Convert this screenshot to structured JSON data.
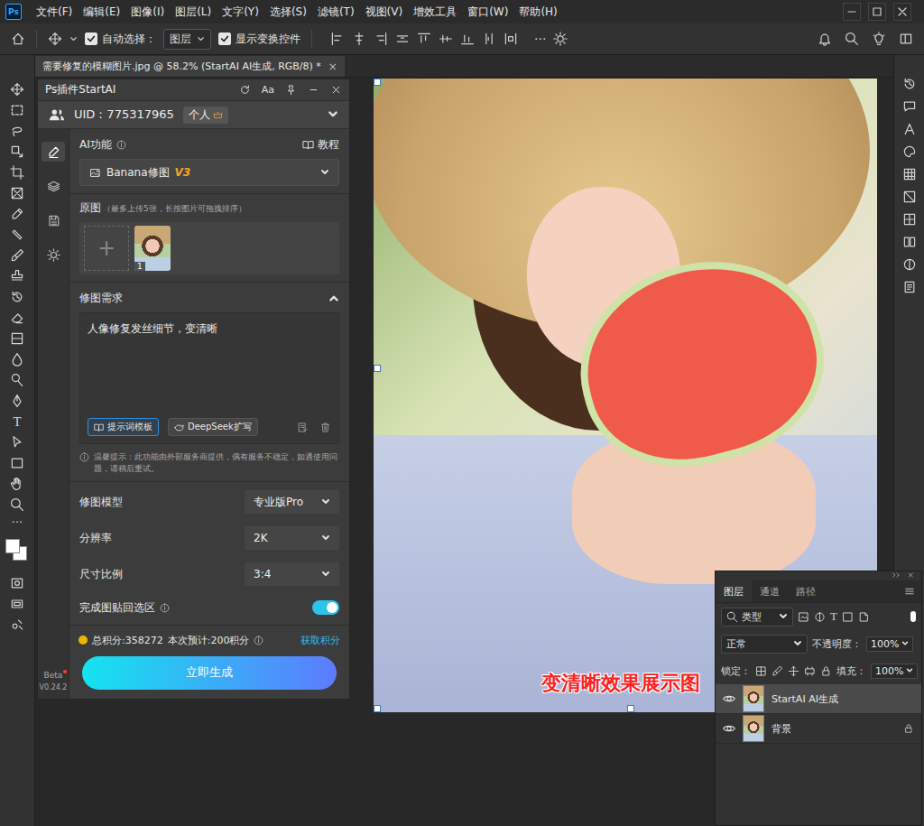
{
  "app": {
    "logo": "Ps"
  },
  "menu": [
    "文件(F)",
    "编辑(E)",
    "图像(I)",
    "图层(L)",
    "文字(Y)",
    "选择(S)",
    "滤镜(T)",
    "视图(V)",
    "增效工具",
    "窗口(W)",
    "帮助(H)"
  ],
  "options_bar": {
    "auto_select": {
      "label": "自动选择：",
      "checked": true
    },
    "target": "图层",
    "show_transform": {
      "label": "显示变换控件",
      "checked": true
    },
    "more": "···"
  },
  "document_tab": {
    "title": "需要修复的模糊图片.jpg @ 58.2% (StartAI AI生成, RGB/8) *",
    "close": "×"
  },
  "toolbar": {
    "type_glyph": "T",
    "more": "···"
  },
  "plugin": {
    "title": "Ps插件StartAI",
    "font_button": "Aa",
    "uid": "UID：775317965",
    "plan": "个人",
    "side_nav": [
      {
        "selected": true
      },
      {
        "selected": false
      },
      {
        "selected": false
      },
      {
        "selected": false
      }
    ],
    "feature_label": "AI功能",
    "tutorial": "教程",
    "feature": "Banana修图",
    "feature_version": "V3",
    "source_label": "原图",
    "source_hint": "（最多上传5张，长按图片可拖拽排序）",
    "add": "+",
    "thumbs": [
      {
        "index": "1"
      }
    ],
    "requirement_label": "修图需求",
    "requirement_expanded": true,
    "prompt": "人像修复发丝细节，变清晰",
    "prompt_buttons": [
      {
        "label": "提示词模板",
        "selected": true
      },
      {
        "label": "DeepSeek扩写",
        "selected": false
      }
    ],
    "notice": "温馨提示：此功能由外部服务商提供，偶有服务不稳定，如遇使用问题，请稍后重试。",
    "settings": [
      {
        "label": "修图模型",
        "value": "专业版Pro"
      },
      {
        "label": "分辨率",
        "value": "2K"
      },
      {
        "label": "尺寸比例",
        "value": "3:4"
      }
    ],
    "paste_back": {
      "label": "完成图贴回选区",
      "on": true
    },
    "points": "总积分:358272",
    "estimate": "本次预计:200积分",
    "get_points": "获取积分",
    "generate": "立即生成",
    "beta": "Beta",
    "version": "V0.24.2"
  },
  "annotation": "变清晰效果展示图",
  "layers_panel": {
    "tabs": [
      {
        "label": "图层",
        "selected": true
      },
      {
        "label": "通道",
        "selected": false
      },
      {
        "label": "路径",
        "selected": false
      }
    ],
    "filter": "类型",
    "type_glyph": "T",
    "blend": "正常",
    "opacity_label": "不透明度：",
    "opacity": "100%",
    "lock_label": "锁定：",
    "fill_label": "填充：",
    "fill": "100%",
    "layers": [
      {
        "name": "StartAI AI生成",
        "visible": true,
        "locked": false,
        "selected": true
      },
      {
        "name": "背景",
        "visible": true,
        "locked": true,
        "selected": false
      }
    ]
  }
}
